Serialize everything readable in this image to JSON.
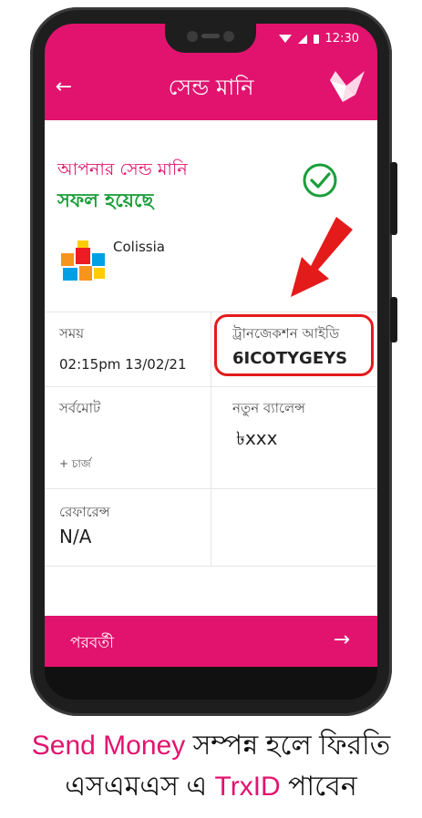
{
  "status_bar": {
    "time": "12:30"
  },
  "header": {
    "title": "সেন্ড মানি"
  },
  "result": {
    "line1": "আপনার সেন্ড মানি",
    "line2": "সফল হয়েছে"
  },
  "merchant": {
    "name": "Colissia"
  },
  "details": {
    "time_label": "সময়",
    "time_value": "02:15pm 13/02/21",
    "trx_label": "ট্রানজেকশন আইডি",
    "trx_value": "6ICOTYGEYS",
    "total_label": "সর্বমোট",
    "charge_label": "+ চার্জ",
    "balance_label": "নতুন ব্যালেন্স",
    "balance_value": "৳xxx",
    "reference_label": "রেফারেন্স",
    "reference_value": "N/A"
  },
  "footer_button": {
    "label": "পরবর্তী"
  },
  "caption": {
    "part1_highlight": "Send Money",
    "part1_rest": " সম্পন্ন হলে ফিরতি",
    "part2_a": "এসএমএস এ ",
    "part2_highlight": "TrxID",
    "part2_b": " পাবেন"
  },
  "colors": {
    "brand": "#e2136e",
    "success": "#1a9e3a",
    "alert": "#e41b1b"
  },
  "icons": [
    "back-arrow-icon",
    "bkash-bird-logo-icon",
    "check-circle-icon",
    "red-arrow-icon",
    "merchant-gift-logo-icon",
    "next-arrow-icon",
    "wifi-icon",
    "signal-icon",
    "battery-icon"
  ]
}
